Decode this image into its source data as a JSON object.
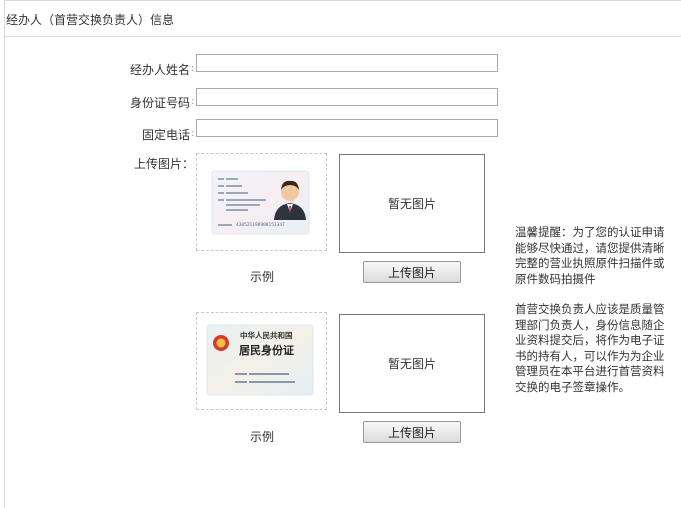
{
  "section_title": "经办人（首营交换负责人）信息",
  "fields": {
    "name_label": "经办人姓名",
    "idno_label": "身份证号码",
    "phone_label": "固定电话",
    "upload_label": "上传图片："
  },
  "front": {
    "preview_text": "暂无图片",
    "upload_button": "上传图片",
    "sample_label": "示例",
    "card_number": "430521198908151347"
  },
  "back": {
    "preview_text": "暂无图片",
    "upload_button": "上传图片",
    "sample_label": "示例",
    "card_title1": "中华人民共和国",
    "card_title2": "居民身份证"
  },
  "tips": {
    "notice": "温馨提醒：为了您的认证申请能够尽快通过，请您提供清晰完整的营业执照原件扫描件或原件数码拍摄件",
    "responsibility": "首营交换负责人应该是质量管理部门负责人，身份信息随企业资料提交后，将作为电子证书的持有人，可以作为为企业管理员在本平台进行首营资料交换的电子签章操作。"
  }
}
